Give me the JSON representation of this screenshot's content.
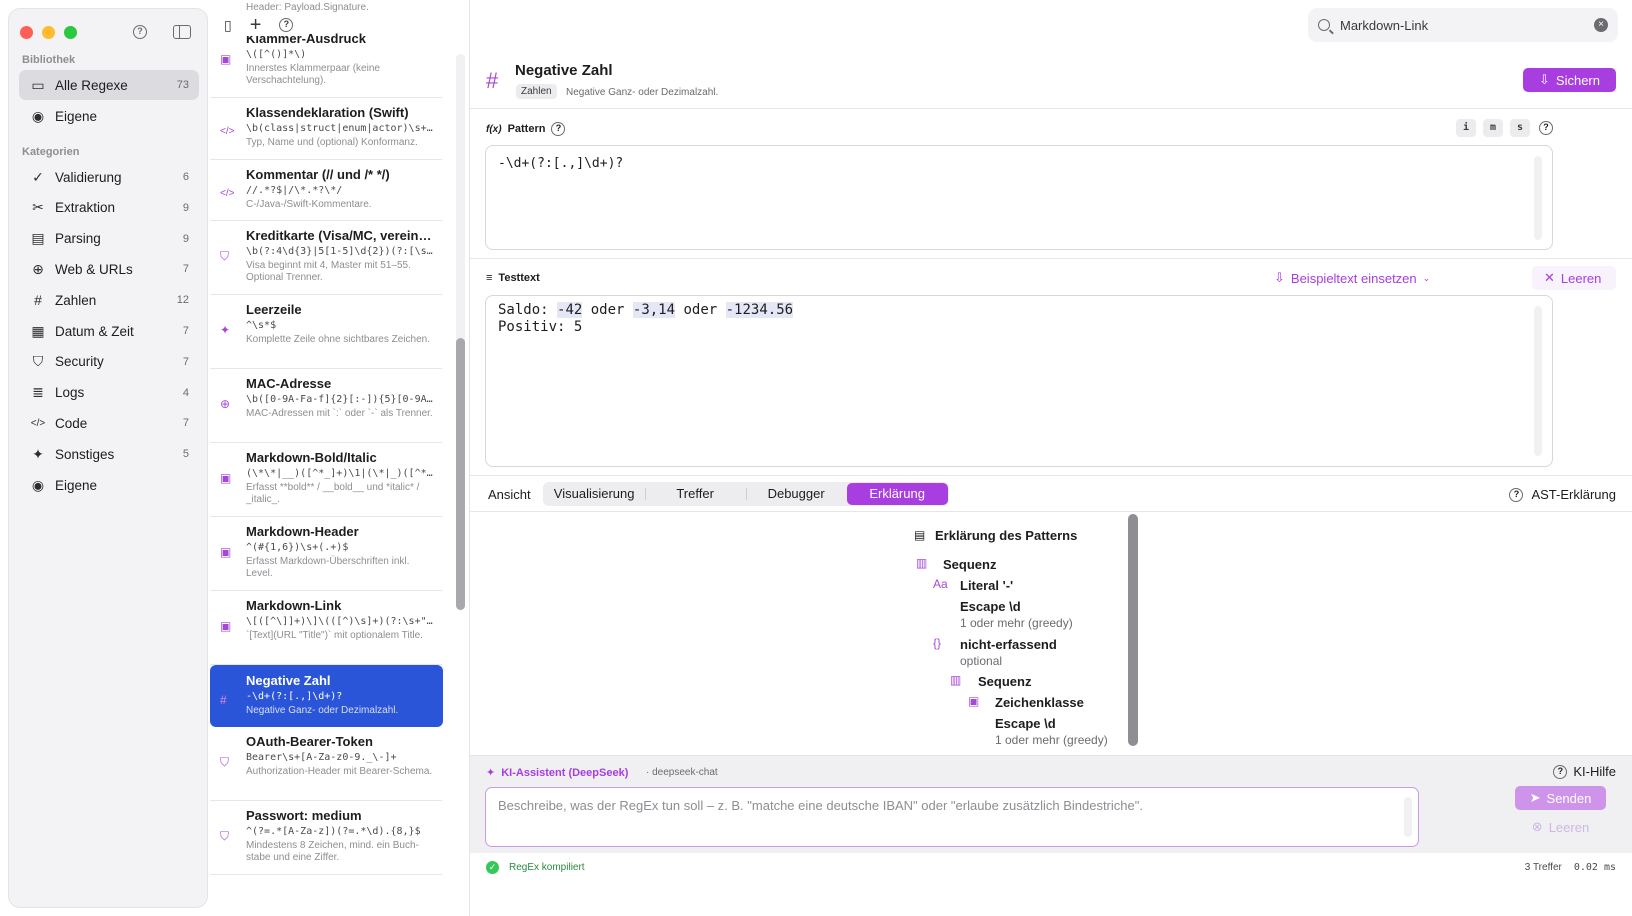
{
  "sidebar": {
    "library_label": "Bibliothek",
    "library_items": [
      {
        "label": "Alle Regexe",
        "count": "73",
        "icon": "tray-icon"
      },
      {
        "label": "Eigene",
        "count": "",
        "icon": "person-icon"
      }
    ],
    "categories_label": "Kategorien",
    "categories": [
      {
        "label": "Validierung",
        "count": "6",
        "icon": "check-seal-icon",
        "glyph": "✓"
      },
      {
        "label": "Extraktion",
        "count": "9",
        "icon": "scissors-icon",
        "glyph": "✂"
      },
      {
        "label": "Parsing",
        "count": "9",
        "icon": "doc-icon",
        "glyph": "▤"
      },
      {
        "label": "Web & URLs",
        "count": "7",
        "icon": "globe-icon",
        "glyph": "⊕"
      },
      {
        "label": "Zahlen",
        "count": "12",
        "icon": "hash-icon",
        "glyph": "#"
      },
      {
        "label": "Datum & Zeit",
        "count": "7",
        "icon": "calendar-icon",
        "glyph": "▦"
      },
      {
        "label": "Security",
        "count": "7",
        "icon": "shield-icon",
        "glyph": "⛉"
      },
      {
        "label": "Logs",
        "count": "4",
        "icon": "list-icon",
        "glyph": "≣"
      },
      {
        "label": "Code",
        "count": "7",
        "icon": "code-icon",
        "glyph": "</>"
      },
      {
        "label": "Sonstiges",
        "count": "5",
        "icon": "sparkle-icon",
        "glyph": "✦"
      },
      {
        "label": "Eigene",
        "count": "",
        "icon": "person-icon",
        "glyph": "◉"
      }
    ]
  },
  "list": {
    "items": [
      {
        "title": "Klammer-Ausdruck",
        "pattern": "\\([^()]*\\)",
        "desc": "Innerstes Klammerpaar (keine Verschachtelung).",
        "icon": "doc-search-icon",
        "glyph": "▣"
      },
      {
        "title": "Klassendeklaration (Swift)",
        "pattern": "\\b(class|struct|enum|actor)\\s+(…",
        "desc": "Typ, Name und (optional) Konformanz.",
        "icon": "code-icon",
        "glyph": "</>"
      },
      {
        "title": "Kommentar (// und /* */)",
        "pattern": "//.*?$|/\\*.*?\\*/",
        "desc": "C-/Java-/Swift-Kommentare.",
        "icon": "code-icon",
        "glyph": "</>"
      },
      {
        "title": "Kreditkarte (Visa/MC, verein…",
        "pattern": "\\b(?:4\\d{3}|5[1-5]\\d{2})(?:[\\s-…",
        "desc": "Visa beginnt mit 4, Master mit 51–55. Optional Trenner.",
        "icon": "shield-icon",
        "glyph": "⛉"
      },
      {
        "title": "Leerzeile",
        "pattern": "^\\s*$",
        "desc": "Komplette Zeile ohne sichtbares Zeichen.",
        "icon": "sparkle-icon",
        "glyph": "✦"
      },
      {
        "title": "MAC-Adresse",
        "pattern": "\\b([0-9A-Fa-f]{2}[:-]){5}[0-9A-…",
        "desc": "MAC-Adressen mit `:` oder `-` als Trenner.",
        "icon": "globe-icon",
        "glyph": "⊕"
      },
      {
        "title": "Markdown-Bold/Italic",
        "pattern": "(\\*\\*|__)([^*_]+)\\1|(\\*|_)([^*_…",
        "desc": "Erfasst **bold** / __bold__ und *italic* / _italic_.",
        "icon": "doc-search-icon",
        "glyph": "▣"
      },
      {
        "title": "Markdown-Header",
        "pattern": "^(#{1,6})\\s+(.+)$",
        "desc": "Erfasst Markdown-Überschriften inkl. Level.",
        "icon": "doc-search-icon",
        "glyph": "▣"
      },
      {
        "title": "Markdown-Link",
        "pattern": "\\[([^\\]]+)\\]\\(([^)\\s]+)(?:\\s+\"(…",
        "desc": "`[Text](URL \"Title\")` mit optionalem Title.",
        "icon": "doc-search-icon",
        "glyph": "▣"
      },
      {
        "title": "Negative Zahl",
        "pattern": "-\\d+(?:[.,]\\d+)?",
        "desc": "Negative Ganz- oder Dezimalzahl.",
        "icon": "hash-icon",
        "glyph": "#"
      },
      {
        "title": "OAuth-Bearer-Token",
        "pattern": "Bearer\\s+[A-Za-z0-9._\\-]+",
        "desc": "Authorization-Header mit Bearer-Schema.",
        "icon": "shield-icon",
        "glyph": "⛉"
      },
      {
        "title": "Passwort: medium",
        "pattern": "^(?=.*[A-Za-z])(?=.*\\d).{8,}$",
        "desc": "Mindestens 8 Zeichen, mind. ein Buch-stabe und eine Ziffer.",
        "icon": "shield-icon",
        "glyph": "⛉"
      }
    ],
    "top_partial": "Header: Payload.Signature."
  },
  "search": {
    "value": "Markdown-Link"
  },
  "detail": {
    "title": "Negative Zahl",
    "tag": "Zahlen",
    "description": "Negative Ganz- oder Dezimalzahl.",
    "save_label": "Sichern",
    "pattern_label": "Pattern",
    "pattern_fx": "f(x)",
    "flags": [
      "i",
      "m",
      "s"
    ],
    "pattern": "-\\d+(?:[.,]\\d+)?",
    "testtext_label": "Testtext",
    "insert_example_label": "Beispieltext einsetzen",
    "clear_label": "Leeren",
    "test_line1": {
      "a": "Saldo: ",
      "m1": "-42",
      "b": " oder ",
      "m2": "-3,14",
      "c": " oder ",
      "m3": "-1234.56"
    },
    "test_line2": "Positiv: 5"
  },
  "tabs": {
    "view_label": "Ansicht",
    "items": [
      "Visualisierung",
      "Treffer",
      "Debugger",
      "Erklärung"
    ],
    "active": "Erklärung",
    "ast_label": "AST-Erklärung"
  },
  "explanation": {
    "title": "Erklärung des Patterns",
    "seq1": "Sequenz",
    "literal": "Literal '-'",
    "escape1": "Escape \\d",
    "escape1_sub": "1 oder mehr (greedy)",
    "noncap": "nicht-erfassend",
    "noncap_sub": "optional",
    "seq2": "Sequenz",
    "charclass": "Zeichenklasse",
    "escape2": "Escape \\d",
    "escape2_sub": "1 oder mehr (greedy)"
  },
  "ai": {
    "title": "KI-Assistent (DeepSeek)",
    "model": "· deepseek-chat",
    "help_label": "KI-Hilfe",
    "placeholder": "Beschreibe, was der RegEx tun soll – z. B. \"matche eine deutsche IBAN\" oder \"erlaube zusätzlich Bindestriche\".",
    "send_label": "Senden",
    "clear_label": "Leeren"
  },
  "status": {
    "compiled": "RegEx kompiliert",
    "matches": "3 Treffer",
    "time": "0.02 ms"
  },
  "colors": {
    "accent": "#a83de0",
    "selection": "#2b55d9",
    "success": "#34c759"
  }
}
